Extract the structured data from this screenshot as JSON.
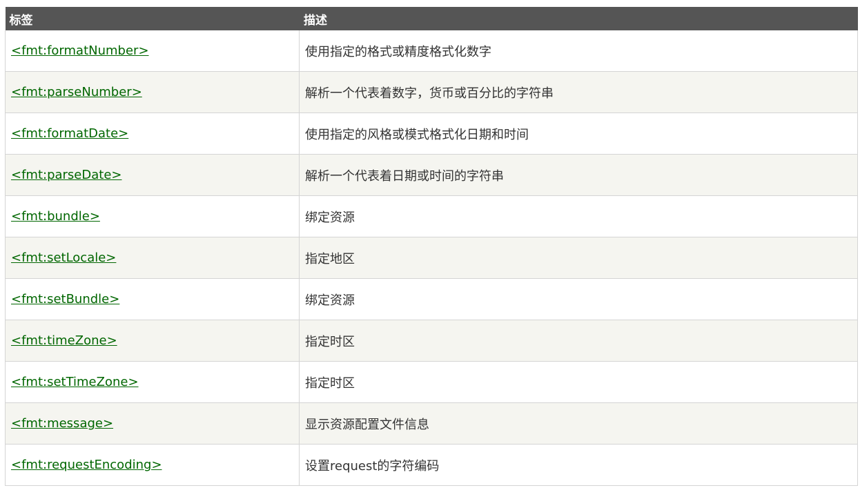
{
  "table": {
    "headers": [
      "标签",
      "描述"
    ],
    "rows": [
      {
        "tag": "<fmt:formatNumber>",
        "desc": "使用指定的格式或精度格式化数字"
      },
      {
        "tag": "<fmt:parseNumber>",
        "desc": "解析一个代表着数字，货币或百分比的字符串"
      },
      {
        "tag": "<fmt:formatDate>",
        "desc": "使用指定的风格或模式格式化日期和时间"
      },
      {
        "tag": "<fmt:parseDate>",
        "desc": "解析一个代表着日期或时间的字符串"
      },
      {
        "tag": "<fmt:bundle>",
        "desc": "绑定资源"
      },
      {
        "tag": "<fmt:setLocale>",
        "desc": "指定地区"
      },
      {
        "tag": "<fmt:setBundle>",
        "desc": "绑定资源"
      },
      {
        "tag": "<fmt:timeZone>",
        "desc": "指定时区"
      },
      {
        "tag": "<fmt:setTimeZone>",
        "desc": "指定时区"
      },
      {
        "tag": "<fmt:message>",
        "desc": "显示资源配置文件信息"
      },
      {
        "tag": "<fmt:requestEncoding>",
        "desc": "设置request的字符编码"
      }
    ]
  },
  "colors": {
    "header_bg": "#555555",
    "header_text": "#ffffff",
    "link": "#006600",
    "alt_row_bg": "#f5f5f0",
    "border": "#d4d4d4"
  }
}
